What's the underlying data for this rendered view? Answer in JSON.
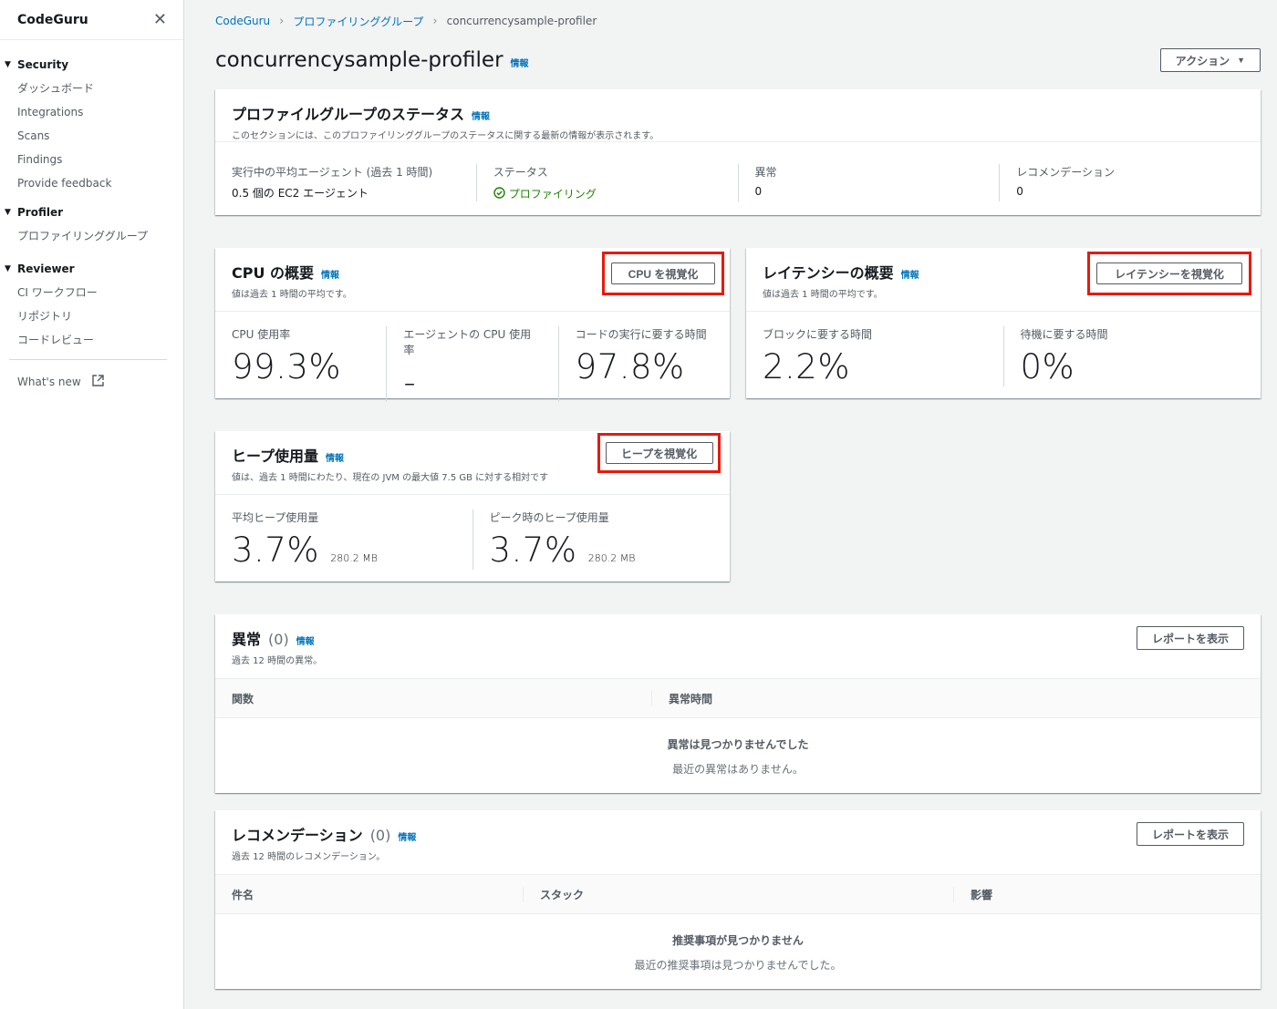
{
  "sidebar": {
    "title": "CodeGuru",
    "sections": [
      {
        "label": "Security",
        "items": [
          "ダッシュボード",
          "Integrations",
          "Scans",
          "Findings",
          "Provide feedback"
        ]
      },
      {
        "label": "Profiler",
        "items": [
          "プロファイリンググループ"
        ]
      },
      {
        "label": "Reviewer",
        "items": [
          "CI ワークフロー",
          "リポジトリ",
          "コードレビュー"
        ]
      }
    ],
    "whats_new": "What's new"
  },
  "breadcrumb": [
    "CodeGuru",
    "プロファイリンググループ",
    "concurrencysample-profiler"
  ],
  "page": {
    "title": "concurrencysample-profiler",
    "info": "情報",
    "actions_label": "アクション"
  },
  "status_card": {
    "title": "プロファイルグループのステータス",
    "desc": "このセクションには、このプロファイリンググループのステータスに関する最新の情報が表示されます。",
    "agents_label": "実行中の平均エージェント (過去 1 時間)",
    "agents_value": "0.5 個の EC2 エージェント",
    "status_label": "ステータス",
    "status_value": "プロファイリング",
    "anomaly_label": "異常",
    "anomaly_value": "0",
    "reco_label": "レコメンデーション",
    "reco_value": "0"
  },
  "cpu_card": {
    "title": "CPU の概要",
    "desc": "値は過去 1 時間の平均です。",
    "button": "CPU を視覚化",
    "metrics": [
      {
        "label": "CPU 使用率",
        "value": "99.3%"
      },
      {
        "label": "エージェントの CPU 使用率",
        "value": "-"
      },
      {
        "label": "コードの実行に要する時間",
        "value": "97.8%"
      }
    ]
  },
  "latency_card": {
    "title": "レイテンシーの概要",
    "desc": "値は過去 1 時間の平均です。",
    "button": "レイテンシーを視覚化",
    "metrics": [
      {
        "label": "ブロックに要する時間",
        "value": "2.2%"
      },
      {
        "label": "待機に要する時間",
        "value": "0%"
      }
    ]
  },
  "heap_card": {
    "title": "ヒープ使用量",
    "desc": "値は、過去 1 時間にわたり、現在の JVM の最大値 7.5 GB に対する相対です",
    "button": "ヒープを視覚化",
    "metrics": [
      {
        "label": "平均ヒープ使用量",
        "value": "3.7%",
        "unit": "280.2 MB"
      },
      {
        "label": "ピーク時のヒープ使用量",
        "value": "3.7%",
        "unit": "280.2 MB"
      }
    ]
  },
  "anomaly_card": {
    "title": "異常",
    "count": "(0)",
    "desc": "過去 12 時間の異常。",
    "button": "レポートを表示",
    "columns": [
      "関数",
      "異常時間"
    ],
    "empty_title": "異常は見つかりませんでした",
    "empty_sub": "最近の異常はありません。"
  },
  "reco_card": {
    "title": "レコメンデーション",
    "count": "(0)",
    "desc": "過去 12 時間のレコメンデーション。",
    "button": "レポートを表示",
    "columns": [
      "件名",
      "スタック",
      "影響"
    ],
    "empty_title": "推奨事項が見つかりません",
    "empty_sub": "最近の推奨事項は見つかりませんでした。"
  },
  "colors": {
    "link": "#0073bb",
    "success": "#1d8102",
    "highlight": "#e8190c"
  }
}
